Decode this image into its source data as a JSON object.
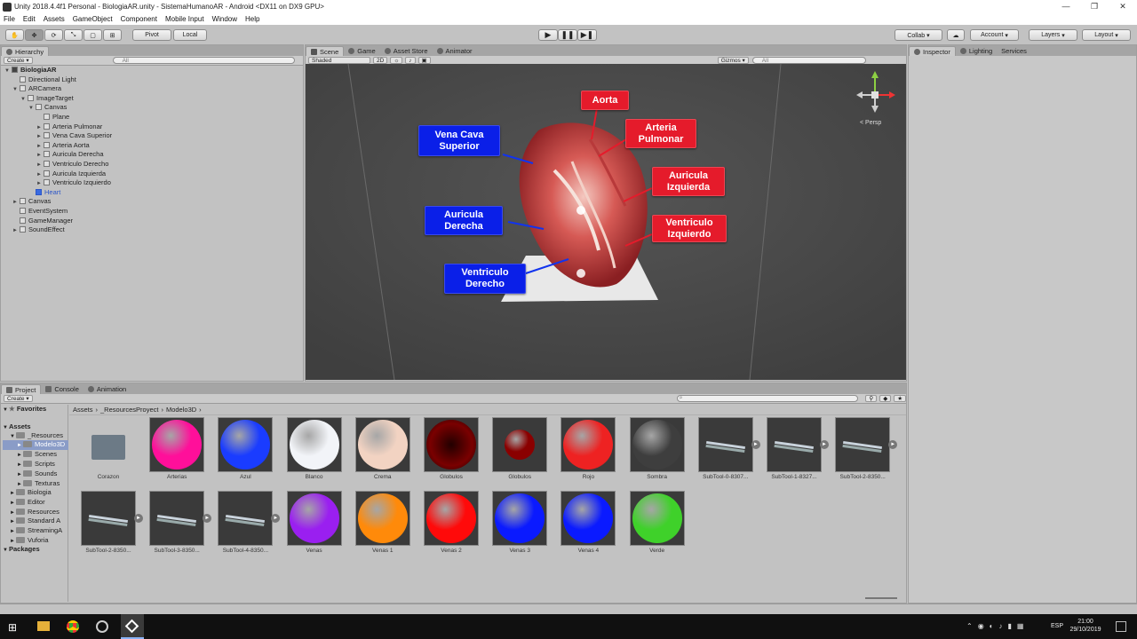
{
  "window": {
    "title": "Unity 2018.4.4f1 Personal - BiologiaAR.unity - SistemaHumanoAR - Android <DX11 on DX9 GPU>",
    "controls": [
      "—",
      "❐",
      "✕"
    ]
  },
  "menu": [
    "File",
    "Edit",
    "Assets",
    "GameObject",
    "Component",
    "Mobile Input",
    "Window",
    "Help"
  ],
  "toolbar": {
    "pivot": "Pivot",
    "local": "Local",
    "collab": "Collab ▾",
    "account": "Account",
    "layers": "Layers",
    "layout": "Layout"
  },
  "hierarchy": {
    "tab": "Hierarchy",
    "create": "Create ▾",
    "search_placeholder": "All",
    "rows": [
      {
        "label": "BiologiaAR",
        "indent": 0,
        "arrow": "▼",
        "bold": true
      },
      {
        "label": "Directional Light",
        "indent": 1,
        "arrow": ""
      },
      {
        "label": "ARCamera",
        "indent": 1,
        "arrow": "▼"
      },
      {
        "label": "ImageTarget",
        "indent": 2,
        "arrow": "▼"
      },
      {
        "label": "Canvas",
        "indent": 3,
        "arrow": "▼"
      },
      {
        "label": "Plane",
        "indent": 4,
        "arrow": ""
      },
      {
        "label": "Arteria Pulmonar",
        "indent": 4,
        "arrow": "►"
      },
      {
        "label": "Vena Cava Superior",
        "indent": 4,
        "arrow": "►"
      },
      {
        "label": "Arteria Aorta",
        "indent": 4,
        "arrow": "►"
      },
      {
        "label": "Auricula Derecha",
        "indent": 4,
        "arrow": "►"
      },
      {
        "label": "Ventriculo Derecho",
        "indent": 4,
        "arrow": "►"
      },
      {
        "label": "Auricula Izquierda",
        "indent": 4,
        "arrow": "►"
      },
      {
        "label": "Ventriculo Izquierdo",
        "indent": 4,
        "arrow": "►"
      },
      {
        "label": "Heart",
        "indent": 3,
        "arrow": "",
        "selected": true
      },
      {
        "label": "Canvas",
        "indent": 1,
        "arrow": "►"
      },
      {
        "label": "EventSystem",
        "indent": 1,
        "arrow": ""
      },
      {
        "label": "GameManager",
        "indent": 1,
        "arrow": ""
      },
      {
        "label": "SoundEffect",
        "indent": 1,
        "arrow": "►"
      }
    ]
  },
  "scene": {
    "tabs": [
      "Scene",
      "Game",
      "Asset Store",
      "Animator"
    ],
    "shading": "Shaded",
    "mode2d": "2D",
    "gizmos": "Gizmos ▾",
    "search_placeholder": "All",
    "persp": "< Persp",
    "labels_red": [
      "Aorta",
      "Arteria Pulmonar",
      "Auricula Izquierda",
      "Ventriculo Izquierdo"
    ],
    "labels_blue": [
      "Vena Cava Superior",
      "Auricula Derecha",
      "Ventriculo Derecho"
    ]
  },
  "inspector": {
    "tabs": [
      "Inspector",
      "Lighting",
      "Services"
    ]
  },
  "project": {
    "tabs": [
      "Project",
      "Console",
      "Animation"
    ],
    "create": "Create ▾",
    "breadcrumb": [
      "Assets",
      "_ResourcesProyect",
      "Modelo3D"
    ],
    "tree": [
      {
        "label": "Favorites",
        "bold": true,
        "indent": 0
      },
      {
        "label": "Assets",
        "bold": true,
        "indent": 0
      },
      {
        "label": "_Resources",
        "indent": 1
      },
      {
        "label": "Modelo3D",
        "indent": 2,
        "selected": true
      },
      {
        "label": "Scenes",
        "indent": 2
      },
      {
        "label": "Scripts",
        "indent": 2
      },
      {
        "label": "Sounds",
        "indent": 2
      },
      {
        "label": "Texturas",
        "indent": 2
      },
      {
        "label": "Biologia",
        "indent": 1
      },
      {
        "label": "Editor",
        "indent": 1
      },
      {
        "label": "Resources",
        "indent": 1
      },
      {
        "label": "Standard A",
        "indent": 1
      },
      {
        "label": "StreamingA",
        "indent": 1
      },
      {
        "label": "Vuforia",
        "indent": 1
      },
      {
        "label": "Packages",
        "bold": true,
        "indent": 0
      }
    ],
    "assets": [
      {
        "name": "Corazon",
        "kind": "folder"
      },
      {
        "name": "Arterias",
        "kind": "sphere",
        "color": "#ff0f9a"
      },
      {
        "name": "Azul",
        "kind": "sphere",
        "color": "#1a3cff"
      },
      {
        "name": "Blanco",
        "kind": "sphere",
        "color": "#f2f4f8"
      },
      {
        "name": "Crema",
        "kind": "sphere",
        "color": "#f2d3c2"
      },
      {
        "name": "Globulos",
        "kind": "sphere-dark",
        "color": "#7a0000"
      },
      {
        "name": "Globulos",
        "kind": "sphere-small",
        "color": "#8a0000"
      },
      {
        "name": "Rojo",
        "kind": "sphere",
        "color": "#ee2222"
      },
      {
        "name": "Sombra",
        "kind": "sphere",
        "color": "#3e3e3e"
      },
      {
        "name": "SubTool-0-8307...",
        "kind": "mesh"
      },
      {
        "name": "SubTool-1-8327...",
        "kind": "mesh"
      },
      {
        "name": "SubTool-2-8350...",
        "kind": "mesh"
      },
      {
        "name": "SubTool-2-8350...",
        "kind": "mesh"
      },
      {
        "name": "SubTool-3-8350...",
        "kind": "mesh"
      },
      {
        "name": "SubTool-4-8350...",
        "kind": "mesh"
      },
      {
        "name": "Venas",
        "kind": "sphere",
        "color": "#9a1ff0"
      },
      {
        "name": "Venas 1",
        "kind": "sphere",
        "color": "#ff8a0a"
      },
      {
        "name": "Venas 2",
        "kind": "sphere",
        "color": "#ff0a0a"
      },
      {
        "name": "Venas 3",
        "kind": "sphere",
        "color": "#0a1aff"
      },
      {
        "name": "Venas 4",
        "kind": "sphere",
        "color": "#0a1aff"
      },
      {
        "name": "Verde",
        "kind": "sphere",
        "color": "#3fd12a"
      }
    ]
  },
  "taskbar": {
    "lang": "ESP",
    "time": "21:00",
    "date": "29/10/2019"
  }
}
